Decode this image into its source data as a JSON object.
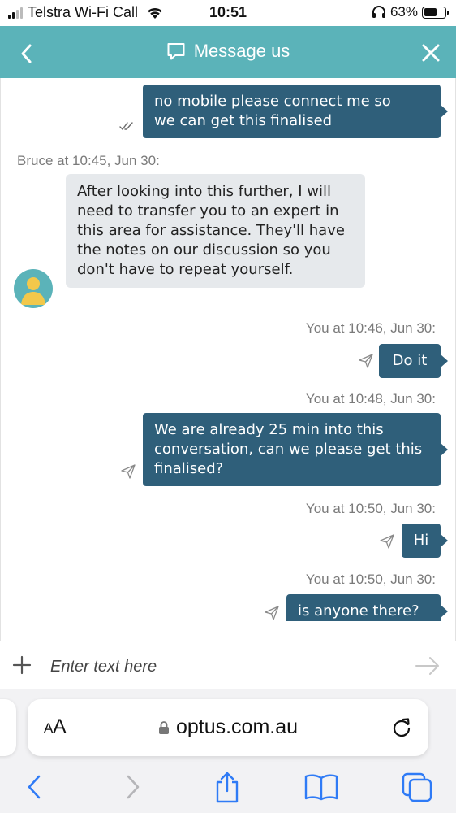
{
  "status_bar": {
    "carrier": "Telstra Wi-Fi Call",
    "time": "10:51",
    "battery_percent": "63%",
    "battery_level": 0.63
  },
  "header": {
    "title": "Message us",
    "color": "#5bb3b9"
  },
  "messages": [
    {
      "direction": "out",
      "text": "no mobile please connect me so\nwe can get this finalised",
      "status_icon": "read-check-icon"
    },
    {
      "direction": "in",
      "meta": "Bruce at 10:45, Jun 30:",
      "text": "After looking into this further, I will need to transfer you to an expert in this area for assistance. They'll have the notes on our discussion so you don't have to repeat yourself."
    },
    {
      "direction": "out",
      "meta": "You at 10:46, Jun 30:",
      "text": "Do it",
      "status_icon": "sent-icon"
    },
    {
      "direction": "out",
      "meta": "You at 10:48, Jun 30:",
      "text": "We are already 25 min into this conversation, can we please get this finalised?",
      "status_icon": "sent-icon"
    },
    {
      "direction": "out",
      "meta": "You at 10:50, Jun 30:",
      "text": "Hi",
      "status_icon": "sent-icon"
    },
    {
      "direction": "out",
      "meta": "You at 10:50, Jun 30:",
      "text": "is anyone there?",
      "status_icon": "sent-icon"
    }
  ],
  "input": {
    "placeholder": "Enter text here"
  },
  "browser": {
    "aa_label_small": "A",
    "aa_label_large": "A",
    "url": "optus.com.au"
  },
  "colors": {
    "outgoing_bubble": "#2f5f7a",
    "incoming_bubble": "#e6e9ec",
    "safari_blue": "#2f7bf6"
  }
}
